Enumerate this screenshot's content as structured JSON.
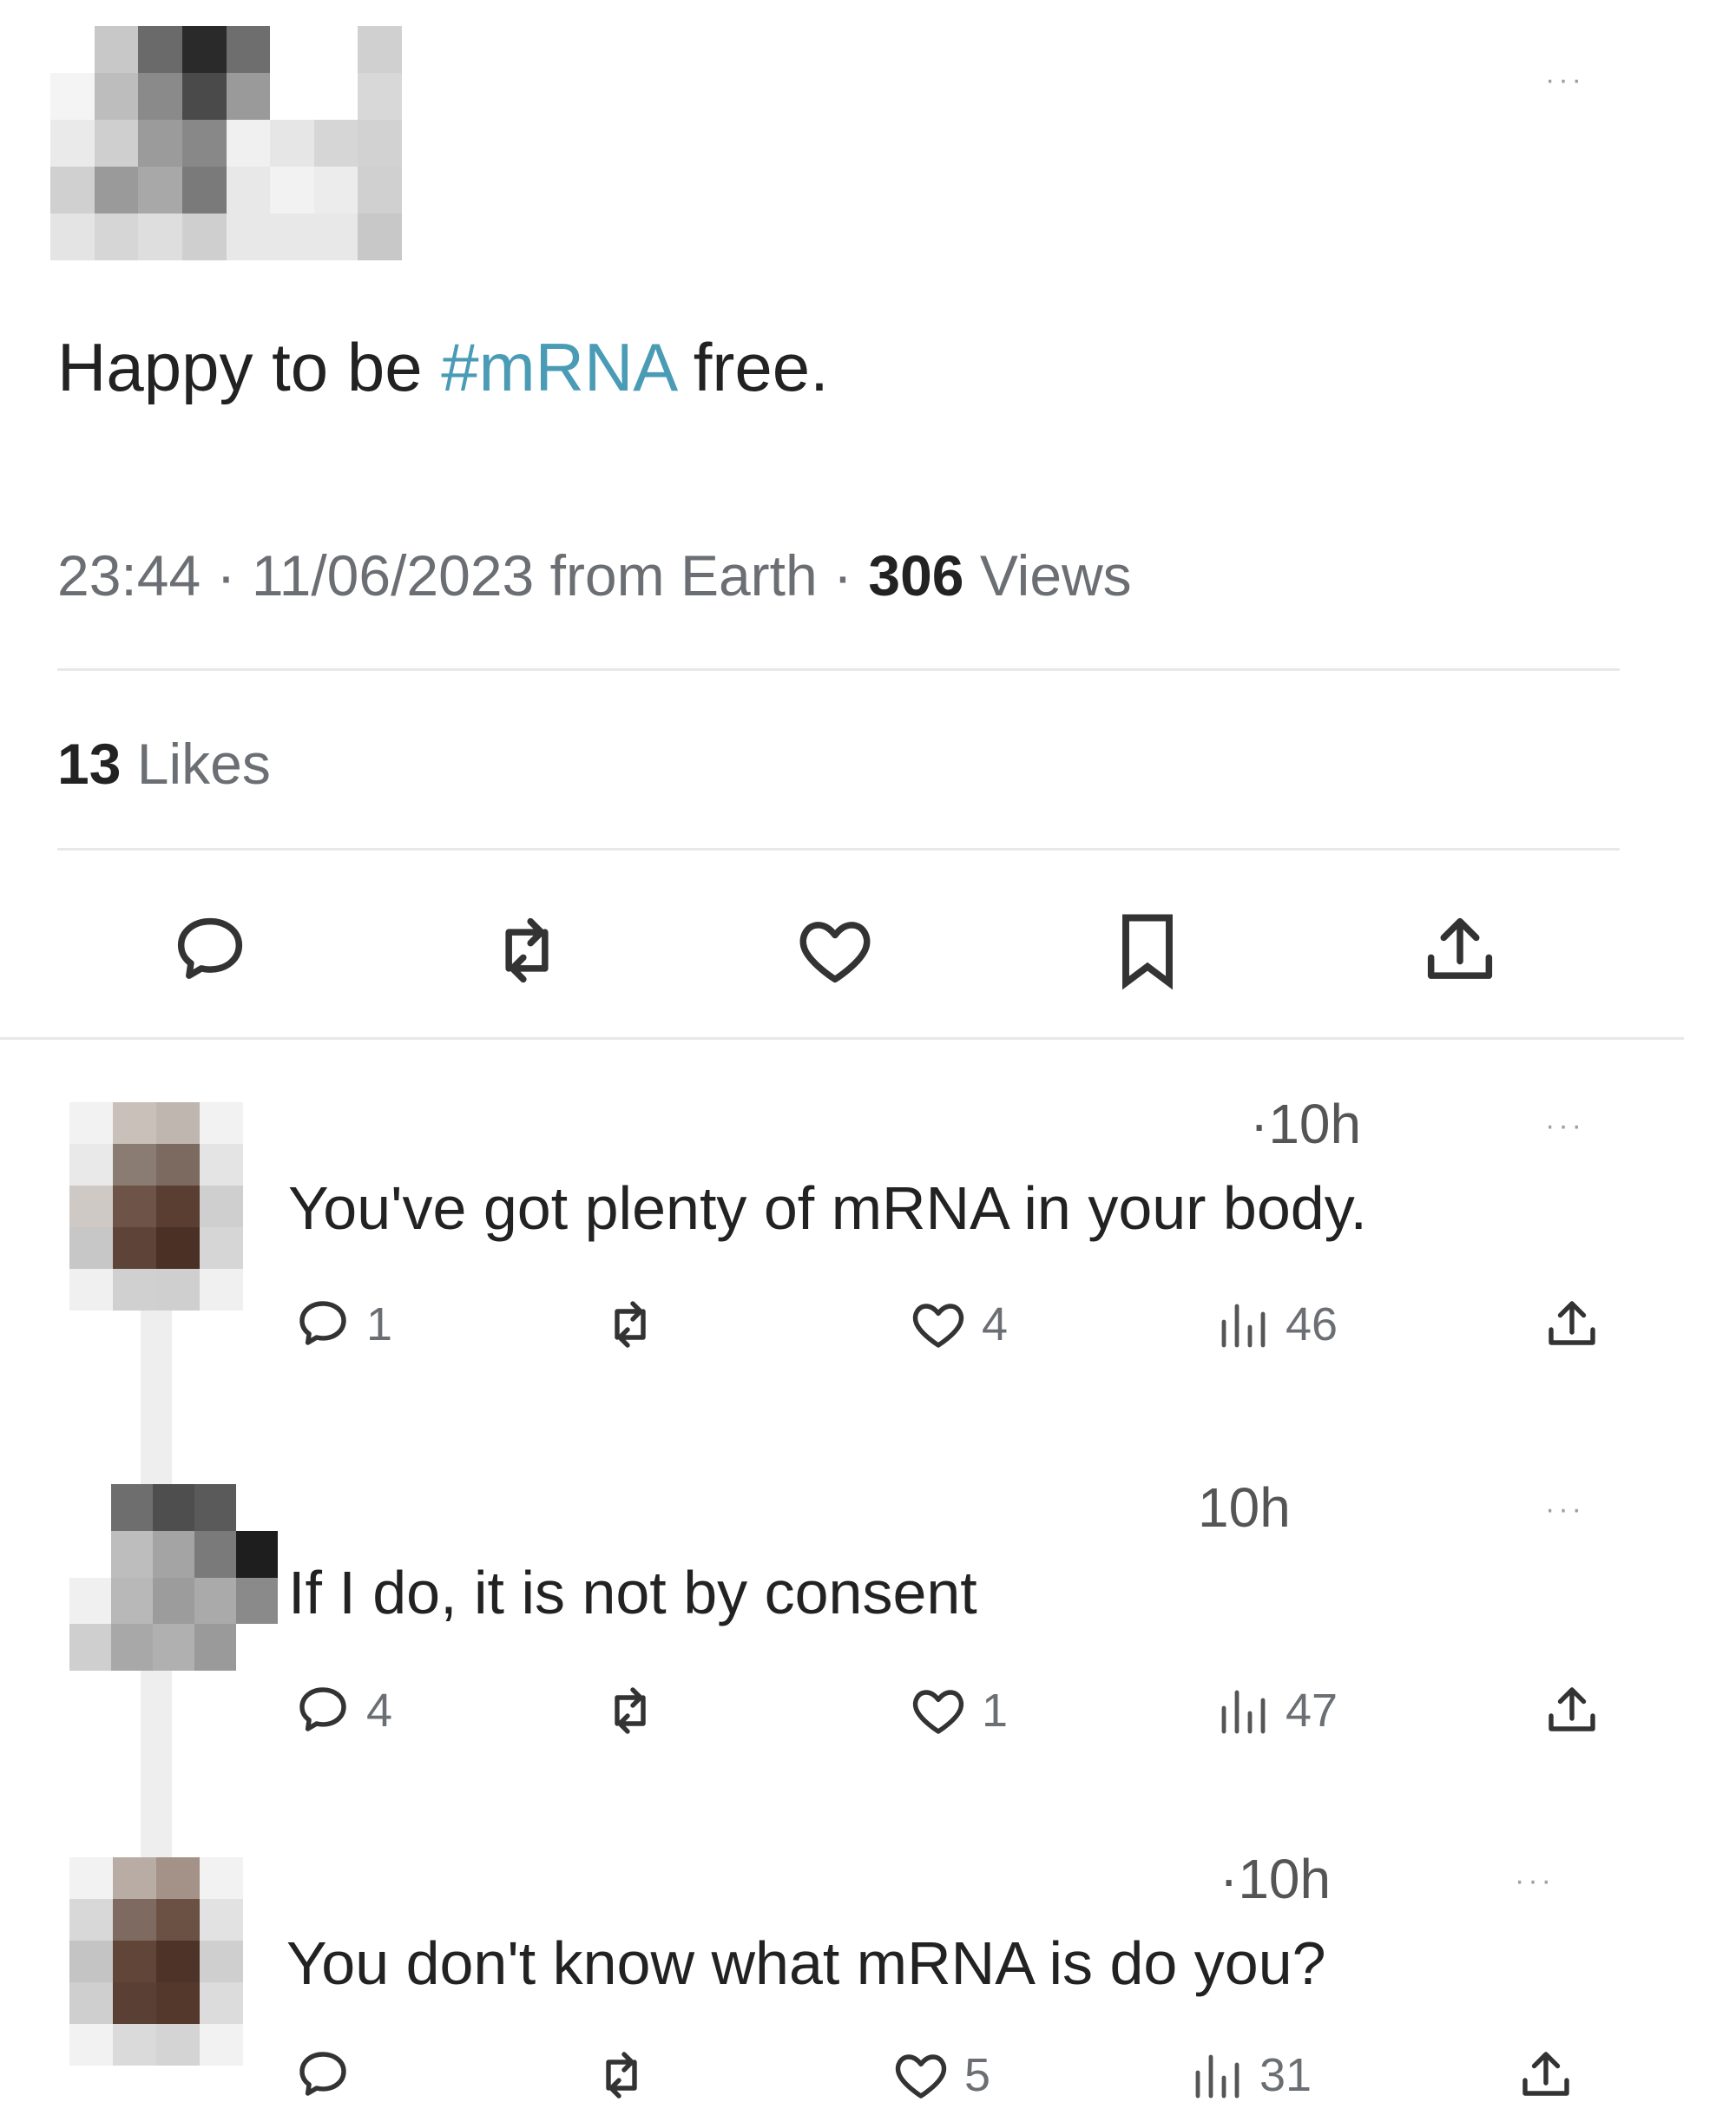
{
  "post": {
    "text_before": "Happy to be ",
    "hashtag": "#mRNA",
    "text_after": " free.",
    "time": "23:44",
    "sep1": " · ",
    "date": "11/06/2023",
    "source": " from Earth",
    "sep2": " · ",
    "views_count": "306",
    "views_label": " Views",
    "likes_count": "13",
    "likes_label": " Likes",
    "more": "···"
  },
  "actions": [
    {
      "name": "reply",
      "icon": "speech-bubble-icon"
    },
    {
      "name": "repost",
      "icon": "repost-arrows-icon"
    },
    {
      "name": "like",
      "icon": "heart-icon"
    },
    {
      "name": "bookmark",
      "icon": "bookmark-icon"
    },
    {
      "name": "share",
      "icon": "share-upload-icon"
    }
  ],
  "replies": [
    {
      "time": "·10h",
      "text": "You've got plenty of mRNA in your body.",
      "replies": "1",
      "reposts": "",
      "likes": "4",
      "views": "46",
      "more": "···"
    },
    {
      "time": "10h",
      "text": "If I do, it is not by consent",
      "replies": "4",
      "reposts": "",
      "likes": "1",
      "views": "47",
      "more": "···"
    },
    {
      "time": "·10h",
      "text": "You don't know what mRNA is do you?",
      "replies": "",
      "reposts": "",
      "likes": "5",
      "views": "31",
      "more": "···"
    }
  ],
  "colors": {
    "hashtag": "#4a9bb5",
    "text": "#222222",
    "muted": "#6b6f74",
    "divider": "#e6e8ea"
  }
}
